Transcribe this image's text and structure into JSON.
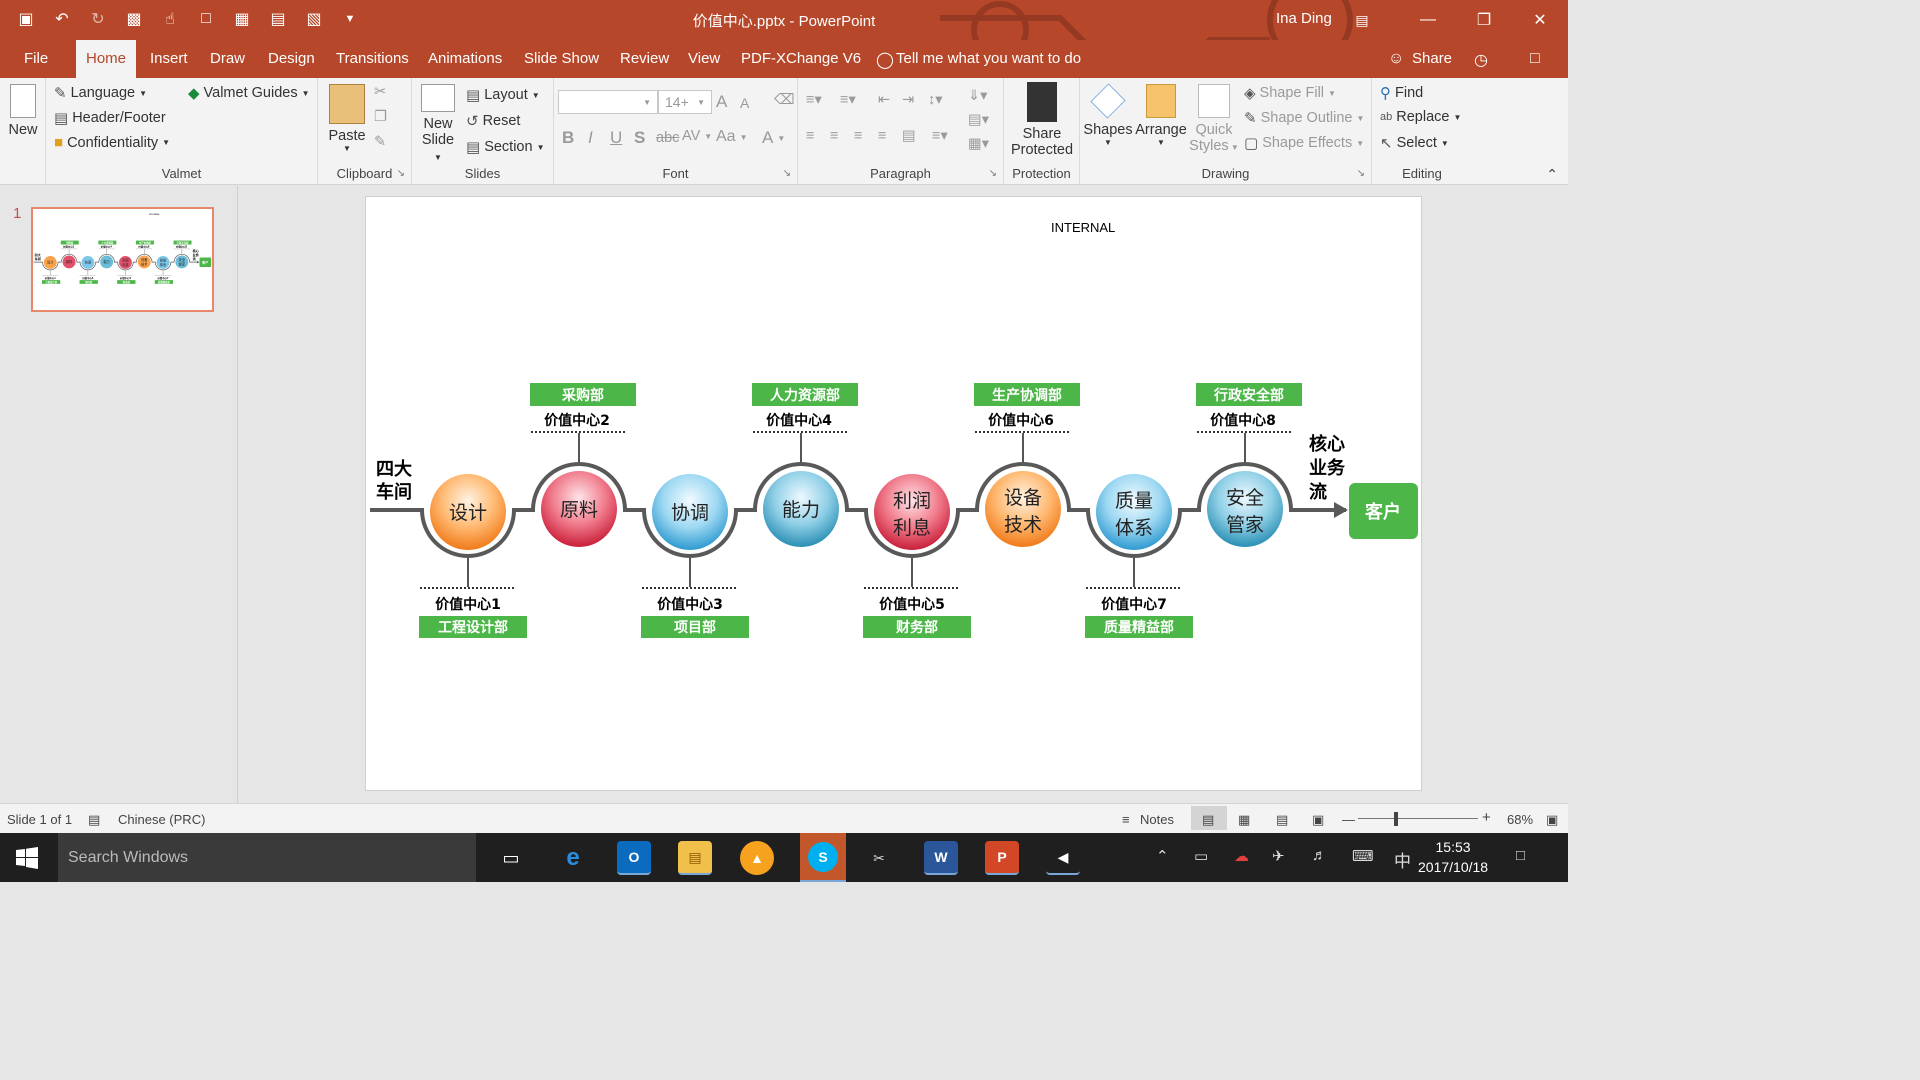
{
  "window": {
    "title": "价值中心.pptx - PowerPoint",
    "user": "Ina Ding"
  },
  "tabs": [
    "File",
    "Home",
    "Insert",
    "Draw",
    "Design",
    "Transitions",
    "Animations",
    "Slide Show",
    "Review",
    "View",
    "PDF-XChange V6"
  ],
  "active_tab": "Home",
  "tell_me": "Tell me what you want to do",
  "share": "Share",
  "ribbon": {
    "new_label": "New",
    "valmet": {
      "language": "Language",
      "header_footer": "Header/Footer",
      "confidentiality": "Confidentiality",
      "guides": "Valmet Guides",
      "group": "Valmet"
    },
    "clipboard": {
      "paste": "Paste",
      "group": "Clipboard"
    },
    "slides": {
      "new_slide_1": "New",
      "new_slide_2": "Slide",
      "layout": "Layout",
      "reset": "Reset",
      "section": "Section",
      "group": "Slides"
    },
    "font": {
      "size": "14+",
      "group": "Font",
      "bold": "B",
      "italic": "I",
      "underline": "U",
      "shadow": "S",
      "strike": "abc",
      "spacing": "AV",
      "case": "Aa",
      "color": "A",
      "grow": "A",
      "shrink": "A"
    },
    "paragraph": {
      "group": "Paragraph"
    },
    "protection": {
      "share_1": "Share",
      "share_2": "Protected",
      "group": "Protection"
    },
    "drawing": {
      "shapes": "Shapes",
      "arrange": "Arrange",
      "quick_1": "Quick",
      "quick_2": "Styles",
      "fill": "Shape Fill",
      "outline": "Shape Outline",
      "effects": "Shape Effects",
      "group": "Drawing"
    },
    "editing": {
      "find": "Find",
      "replace": "Replace",
      "select": "Select",
      "group": "Editing"
    }
  },
  "thumbnail": {
    "number": "1"
  },
  "slide": {
    "internal": "INTERNAL",
    "left_label_1": "四大",
    "left_label_2": "车间",
    "right_label_1": "核心",
    "right_label_2": "业务",
    "right_label_3": "流",
    "customer": "客户",
    "nodes": [
      {
        "line1": "设计",
        "line2": "",
        "center": "价值中心1",
        "dept": "工程设计部",
        "color": "orange"
      },
      {
        "line1": "原料",
        "line2": "",
        "center": "价值中心2",
        "dept": "采购部",
        "color": "red"
      },
      {
        "line1": "协调",
        "line2": "",
        "center": "价值中心3",
        "dept": "项目部",
        "color": "blue"
      },
      {
        "line1": "能力",
        "line2": "",
        "center": "价值中心4",
        "dept": "人力资源部",
        "color": "teal"
      },
      {
        "line1": "利润",
        "line2": "利息",
        "center": "价值中心5",
        "dept": "财务部",
        "color": "red"
      },
      {
        "line1": "设备",
        "line2": "技术",
        "center": "价值中心6",
        "dept": "生产协调部",
        "color": "orange"
      },
      {
        "line1": "质量",
        "line2": "体系",
        "center": "价值中心7",
        "dept": "质量精益部",
        "color": "blue"
      },
      {
        "line1": "安全",
        "line2": "管家",
        "center": "价值中心8",
        "dept": "行政安全部",
        "color": "teal"
      }
    ]
  },
  "status": {
    "slide": "Slide 1 of 1",
    "language": "Chinese (PRC)",
    "notes": "Notes",
    "zoom": "68%"
  },
  "taskbar": {
    "search": "Search Windows",
    "time": "15:53",
    "date": "2017/10/18",
    "ime": "中"
  },
  "colors": {
    "accent": "#b7472a",
    "green": "#4cb748"
  }
}
